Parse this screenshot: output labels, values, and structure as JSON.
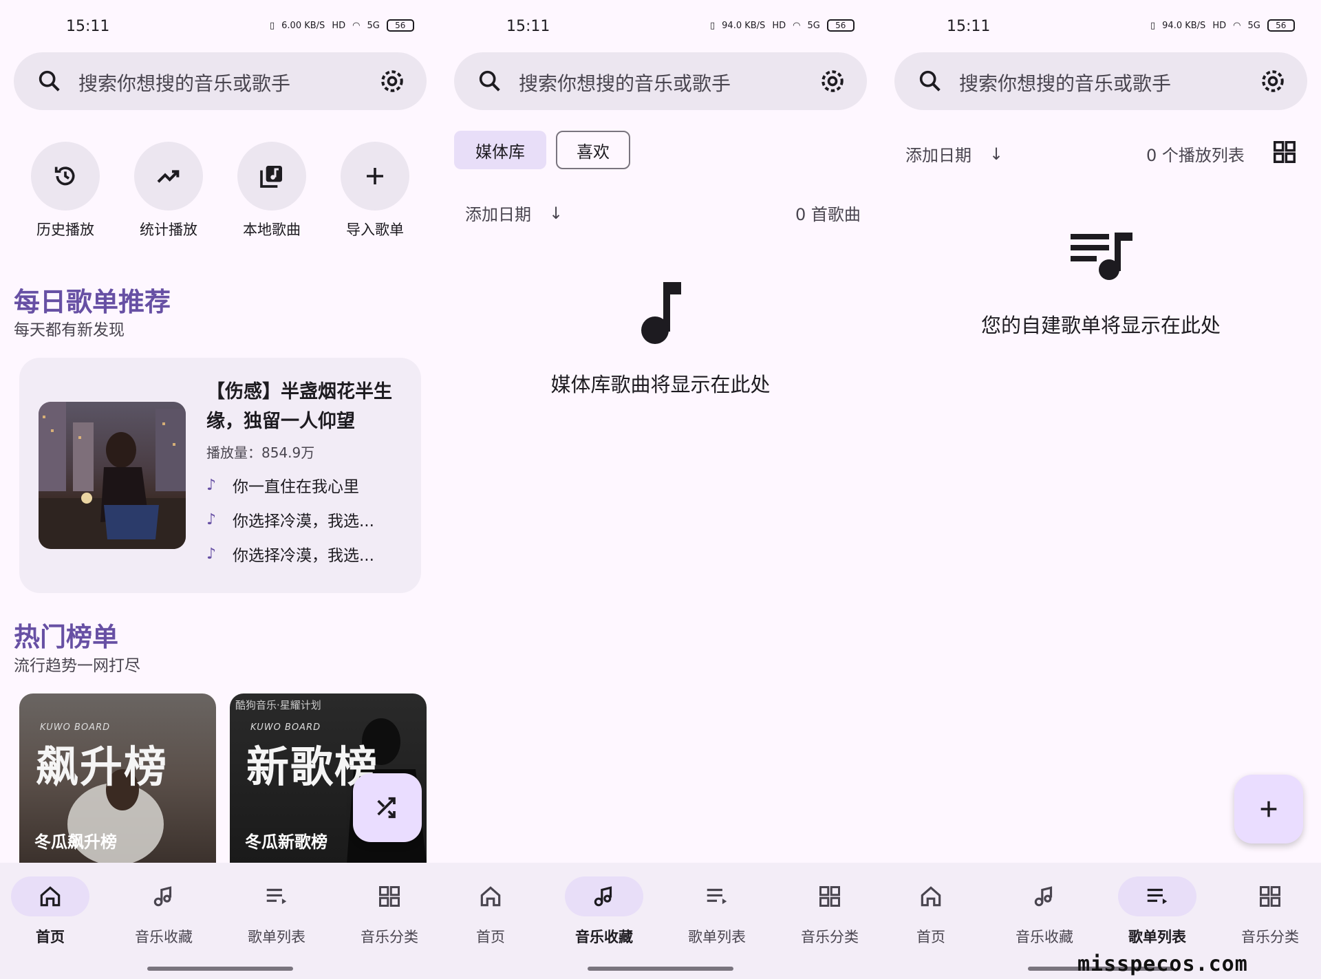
{
  "status_bar": {
    "time": "15:11",
    "speeds": [
      "6.00 KB/S",
      "94.0 KB/S",
      "94.0 KB/S"
    ],
    "hd": "HD",
    "network": "5G",
    "battery": "56"
  },
  "search": {
    "placeholder": "搜索你想搜的音乐或歌手"
  },
  "home": {
    "quick_actions": [
      {
        "label": "历史播放",
        "icon": "history-icon"
      },
      {
        "label": "统计播放",
        "icon": "trending-icon"
      },
      {
        "label": "本地歌曲",
        "icon": "library-music-icon"
      },
      {
        "label": "导入歌单",
        "icon": "add-icon"
      }
    ],
    "daily": {
      "title": "每日歌单推荐",
      "subtitle": "每天都有新发现",
      "playlist_title": "【伤感】半盏烟花半生缘，独留一人仰望",
      "plays": "播放量：854.9万",
      "songs": [
        "你一直住在我心里",
        "你选择冷漠，我选...",
        "你选择冷漠，我选..."
      ]
    },
    "hot": {
      "title": "热门榜单",
      "subtitle": "流行趋势一网打尽",
      "charts": [
        {
          "top_text": "",
          "brand": "KUWO BOARD",
          "big": "飙升榜",
          "name": "冬瓜飙升榜"
        },
        {
          "top_text": "酷狗音乐·星耀计划",
          "brand": "KUWO BOARD",
          "big": "新歌榜",
          "name": "冬瓜新歌榜"
        }
      ]
    }
  },
  "library": {
    "chips": [
      "媒体库",
      "喜欢"
    ],
    "sort_label": "添加日期",
    "count": "0 首歌曲",
    "empty_text": "媒体库歌曲将显示在此处"
  },
  "playlists": {
    "sort_label": "添加日期",
    "count": "0 个播放列表",
    "empty_text": "您的自建歌单将显示在此处"
  },
  "nav": {
    "items": [
      {
        "label": "首页",
        "icon": "home-icon"
      },
      {
        "label": "音乐收藏",
        "icon": "music-collection-icon"
      },
      {
        "label": "歌单列表",
        "icon": "playlist-icon"
      },
      {
        "label": "音乐分类",
        "icon": "category-grid-icon"
      }
    ]
  },
  "watermark": "misspecos.com",
  "colors": {
    "accent": "#6750a4",
    "surface": "#fef7ff",
    "container": "#ece6f0",
    "active_pill": "#e8def8",
    "fab": "#eaddff"
  }
}
